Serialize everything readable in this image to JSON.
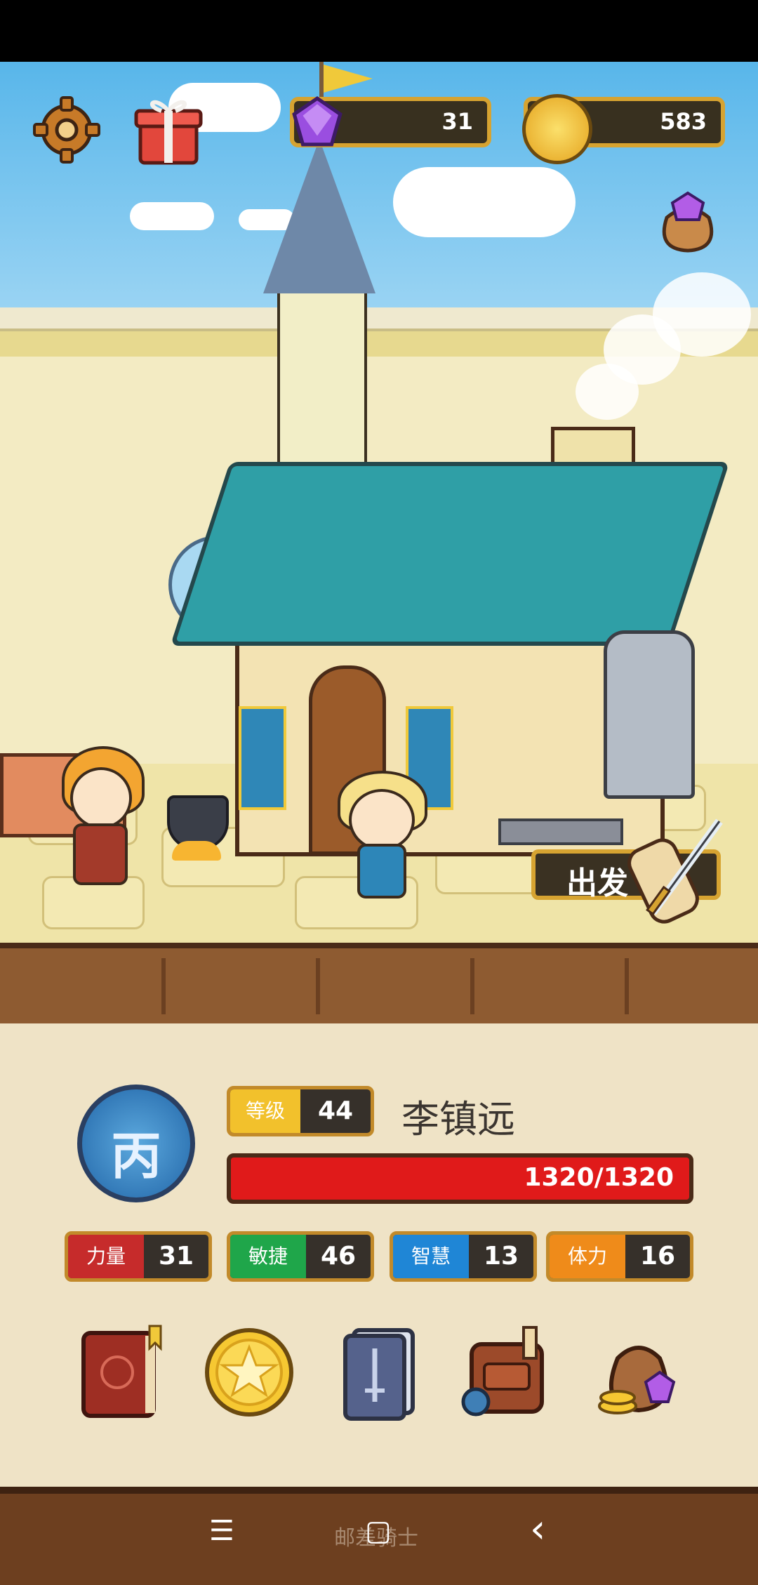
{
  "hud": {
    "settings_icon": "gear-icon",
    "gift_icon": "gift-icon",
    "gems": "31",
    "coins": "583",
    "gem_bag_icon": "gem-bag-icon"
  },
  "scene": {
    "depart_label": "出发"
  },
  "character": {
    "rank": "丙",
    "level_label": "等级",
    "level": "44",
    "name": "李镇远",
    "hp": "1320/1320",
    "hp_fraction": 1.0,
    "stats": [
      {
        "label": "力量",
        "value": "31",
        "color": "#c62b2b"
      },
      {
        "label": "敏捷",
        "value": "46",
        "color": "#1fa64a"
      },
      {
        "label": "智慧",
        "value": "13",
        "color": "#1f86d6"
      },
      {
        "label": "体力",
        "value": "16",
        "color": "#ef8b1a"
      }
    ]
  },
  "menu": [
    {
      "icon": "journal-book-icon"
    },
    {
      "icon": "star-coin-icon"
    },
    {
      "icon": "sword-cards-icon"
    },
    {
      "icon": "backpack-icon"
    },
    {
      "icon": "treasure-bag-icon"
    }
  ],
  "nav": {
    "menu_glyph": "☰",
    "home_glyph": "▢",
    "back_glyph": "‹",
    "app_name": "邮差骑士"
  }
}
